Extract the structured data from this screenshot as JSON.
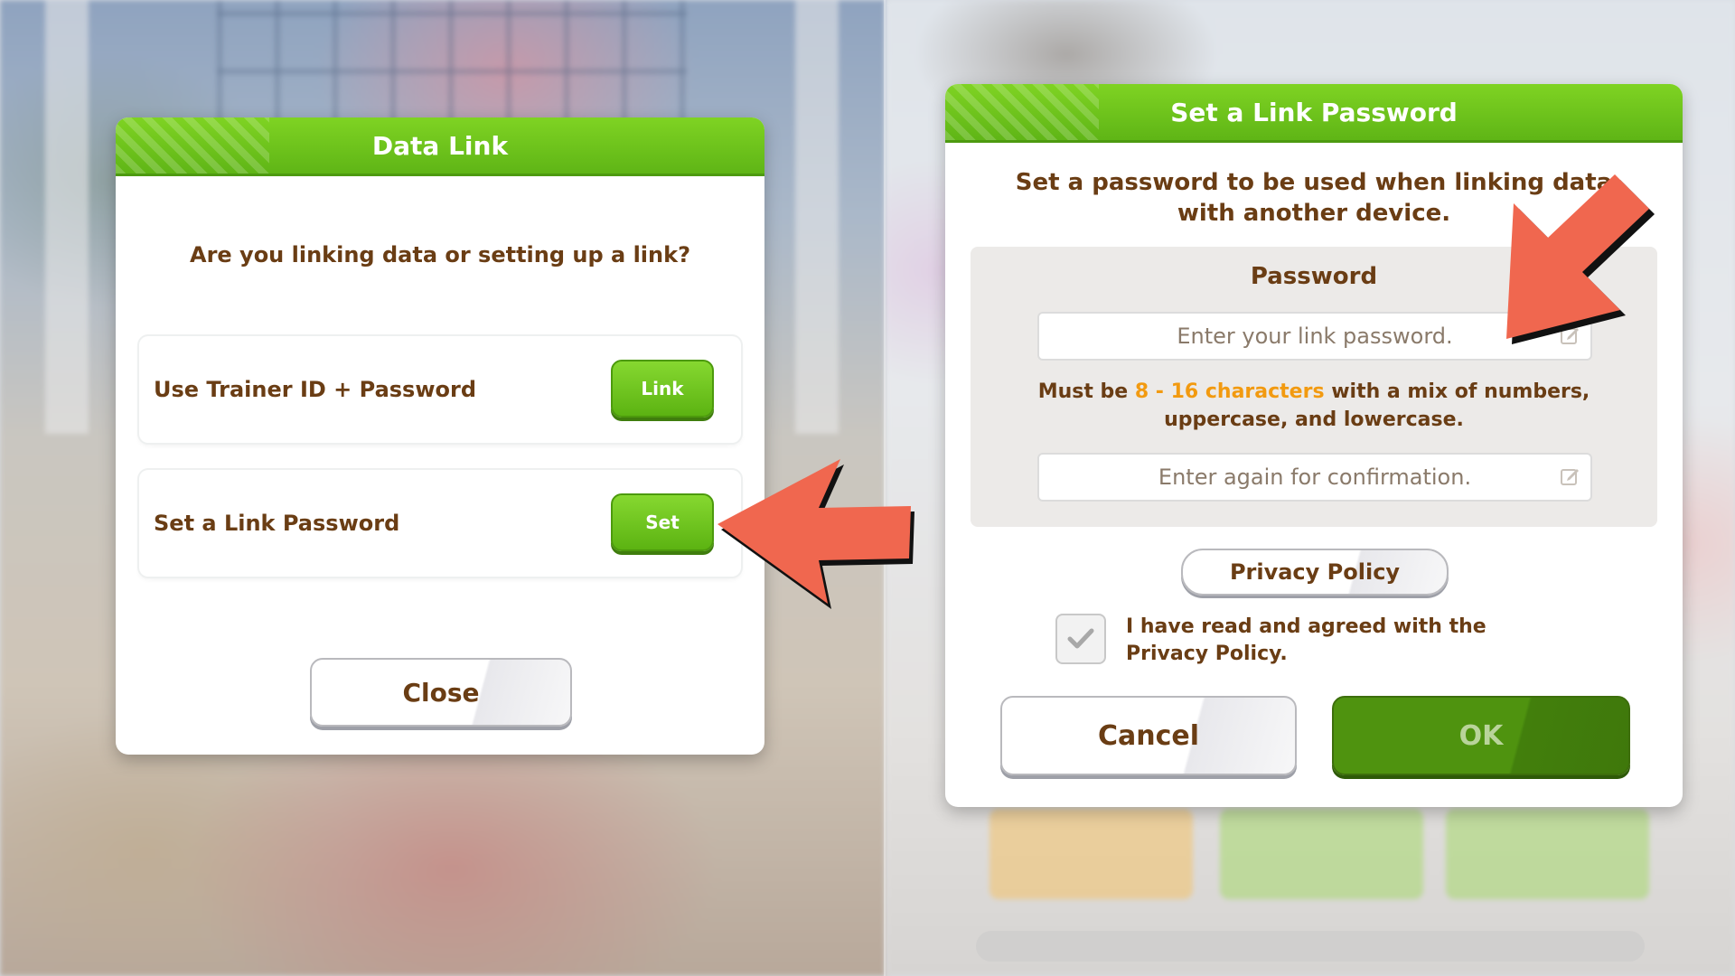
{
  "data_link_dialog": {
    "title": "Data Link",
    "question": "Are you linking data or setting up a link?",
    "options": [
      {
        "label": "Use Trainer ID + Password",
        "button": "Link"
      },
      {
        "label": "Set a Link Password",
        "button": "Set"
      }
    ],
    "close_label": "Close"
  },
  "set_password_dialog": {
    "title": "Set a Link Password",
    "description_line1": "Set a password to be used when linking data",
    "description_line2": "with another device.",
    "password_label": "Password",
    "password_placeholder": "Enter your link password.",
    "rule_prefix": "Must be ",
    "rule_highlight": "8 - 16 characters",
    "rule_suffix": " with a mix of numbers,",
    "rule_line2": "uppercase, and lowercase.",
    "confirm_placeholder": "Enter again for confirmation.",
    "privacy_label": "Privacy Policy",
    "agree_text": "I have read and agreed with the Privacy Policy.",
    "agree_checked": true,
    "cancel_label": "Cancel",
    "ok_label": "OK"
  },
  "colors": {
    "header_green": "#6cc41c",
    "text_brown": "#6a3d14",
    "highlight_orange": "#f29a10",
    "arrow_red": "#f0674f"
  },
  "icons": [
    "edit-icon",
    "checkmark-icon",
    "arrow-annotation"
  ]
}
